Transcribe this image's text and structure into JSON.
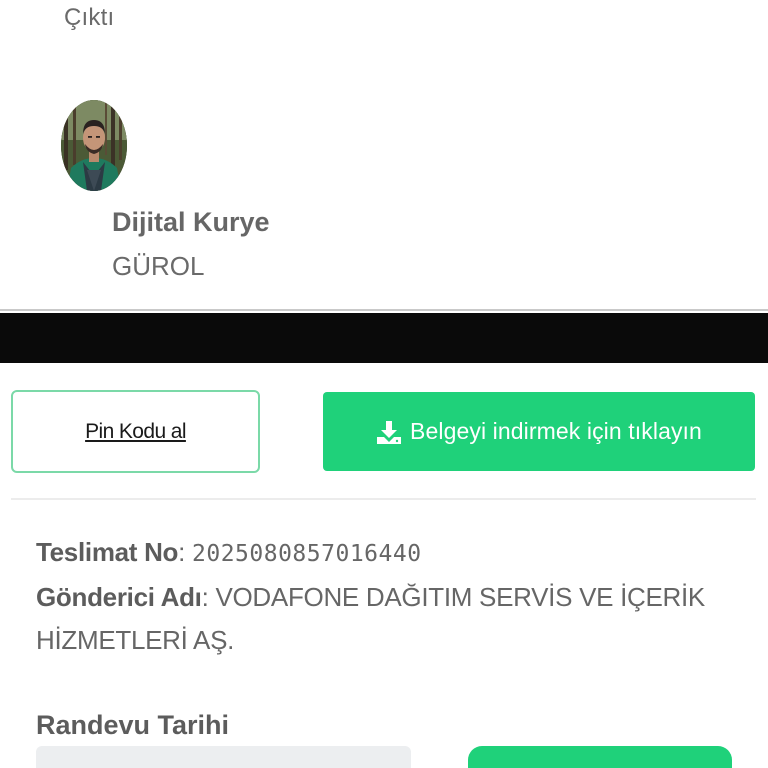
{
  "status": {
    "text": "Çıktı"
  },
  "courier": {
    "title": "Dijital Kurye",
    "name": "GÜROL",
    "avatar_icon": "person-photo"
  },
  "actions": {
    "pin_label": "Pin Kodu al",
    "download_label": "Belgeyi indirmek için tıklayın",
    "download_icon": "download-icon"
  },
  "delivery": {
    "tracking_key": "Teslimat No",
    "tracking_value": "2025080857016440",
    "sender_key": "Gönderici Adı",
    "sender_value": "VODAFONE DAĞITIM SERVİS VE İÇERİK HİZMETLERİ AŞ."
  },
  "appointment": {
    "label": "Randevu Tarihi",
    "button_label": ""
  },
  "colors": {
    "accent_green": "#1fd17a",
    "outline_green": "#7bd9a8",
    "text_gray": "#666666"
  }
}
